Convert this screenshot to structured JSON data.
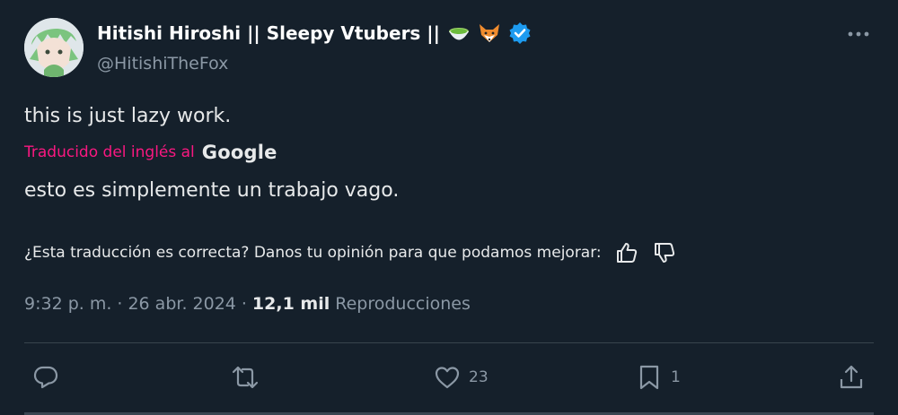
{
  "author": {
    "name": "Hitishi Hiroshi || Sleepy Vtubers ||",
    "handle": "@HitishiTheFox",
    "badges": [
      "matcha-bowl-icon",
      "fox-icon",
      "verified-icon"
    ]
  },
  "tweet": {
    "text": "this is just lazy work.",
    "translation_label": "Traducido del inglés al",
    "translation_brand": "Google",
    "translated_text": "esto es simplemente un trabajo vago.",
    "feedback_prompt": "¿Esta traducción es correcta? Danos tu opinión para que podamos mejorar:"
  },
  "meta": {
    "time": "9:32 p. m.",
    "date": "26 abr. 2024",
    "views_count": "12,1 mil",
    "views_label": "Reproducciones",
    "separator": "·"
  },
  "actions": {
    "reply": {
      "icon": "reply-icon",
      "count": ""
    },
    "retweet": {
      "icon": "retweet-icon",
      "count": ""
    },
    "like": {
      "icon": "heart-icon",
      "count": "23"
    },
    "bookmark": {
      "icon": "bookmark-icon",
      "count": "1"
    },
    "share": {
      "icon": "share-icon",
      "count": ""
    }
  },
  "colors": {
    "background": "#15202b",
    "primary_text": "#e7e9ea",
    "secondary_text": "#8b98a5",
    "translation_accent": "#f91880",
    "verified": "#1d9bf0"
  }
}
